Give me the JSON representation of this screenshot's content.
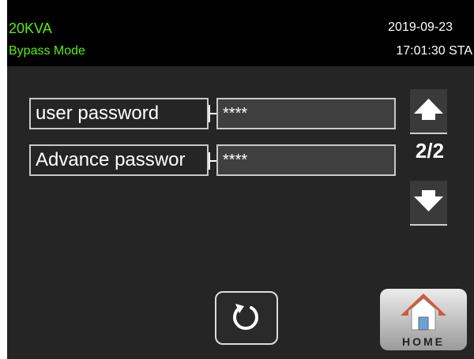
{
  "status": {
    "rating": "20KVA",
    "mode": "Bypass Mode",
    "date": "2019-09-23",
    "time": "17:01:30 STA"
  },
  "fields": [
    {
      "label": "user password",
      "value": "****"
    },
    {
      "label": "Advance passwor",
      "value": "****"
    }
  ],
  "pagination": {
    "indicator": "2/2"
  },
  "home": {
    "label": "HOME"
  },
  "colors": {
    "status_text": "#55ee11",
    "background": "#252525",
    "status_bar": "#000000"
  }
}
